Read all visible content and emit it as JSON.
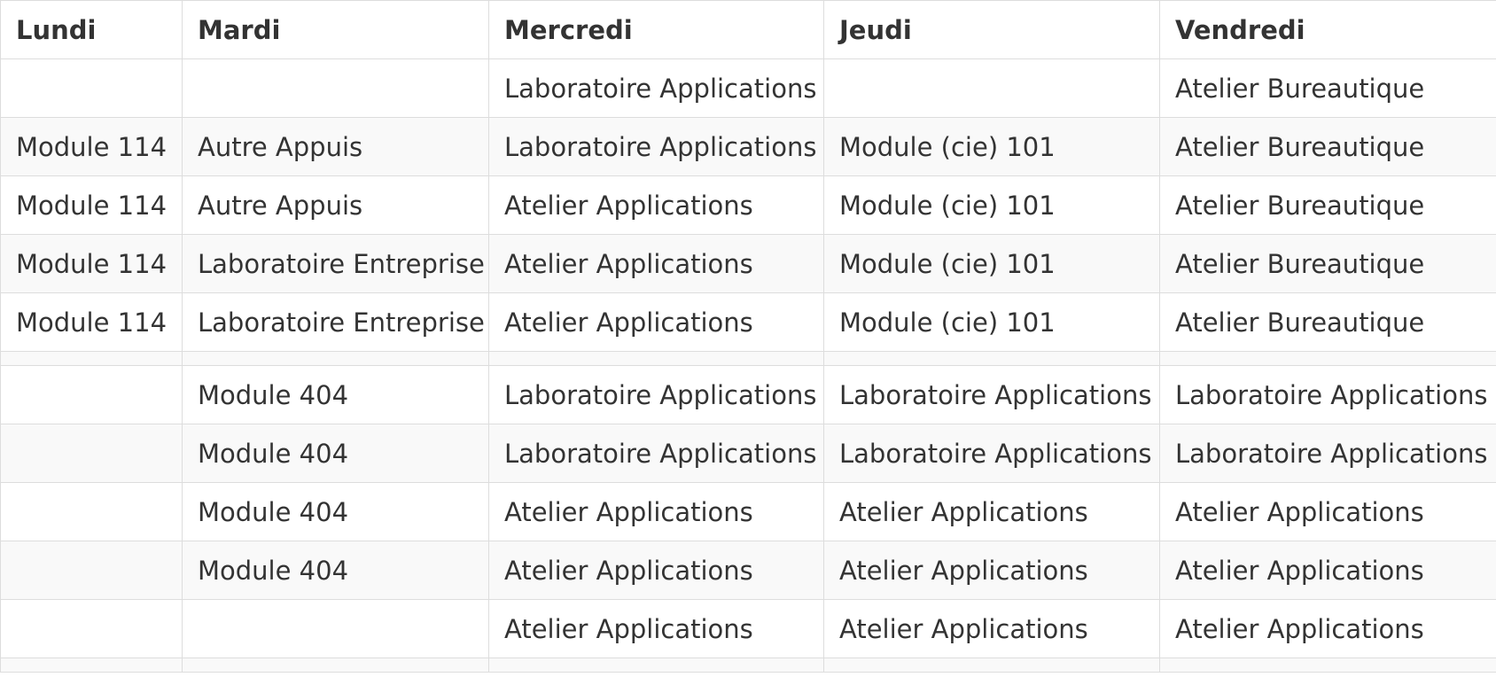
{
  "headers": [
    "Lundi",
    "Mardi",
    "Mercredi",
    "Jeudi",
    "Vendredi"
  ],
  "rows": [
    [
      "",
      "",
      "Laboratoire Applications",
      "",
      "Atelier Bureautique"
    ],
    [
      "Module 114",
      "Autre Appuis",
      "Laboratoire Applications",
      "Module (cie) 101",
      "Atelier Bureautique"
    ],
    [
      "Module 114",
      "Autre Appuis",
      "Atelier Applications",
      "Module (cie) 101",
      "Atelier Bureautique"
    ],
    [
      "Module 114",
      "Laboratoire Entreprise",
      "Atelier Applications",
      "Module (cie) 101",
      "Atelier Bureautique"
    ],
    [
      "Module 114",
      "Laboratoire Entreprise",
      "Atelier Applications",
      "Module (cie) 101",
      "Atelier Bureautique"
    ],
    [
      "",
      "",
      "",
      "",
      ""
    ],
    [
      "",
      "Module 404",
      "Laboratoire Applications",
      "Laboratoire Applications",
      "Laboratoire Applications"
    ],
    [
      "",
      "Module 404",
      "Laboratoire Applications",
      "Laboratoire Applications",
      "Laboratoire Applications"
    ],
    [
      "",
      "Module 404",
      "Atelier Applications",
      "Atelier Applications",
      "Atelier Applications"
    ],
    [
      "",
      "Module 404",
      "Atelier Applications",
      "Atelier Applications",
      "Atelier Applications"
    ],
    [
      "",
      "",
      "Atelier Applications",
      "Atelier Applications",
      "Atelier Applications"
    ],
    [
      "",
      "",
      "",
      "",
      ""
    ]
  ]
}
